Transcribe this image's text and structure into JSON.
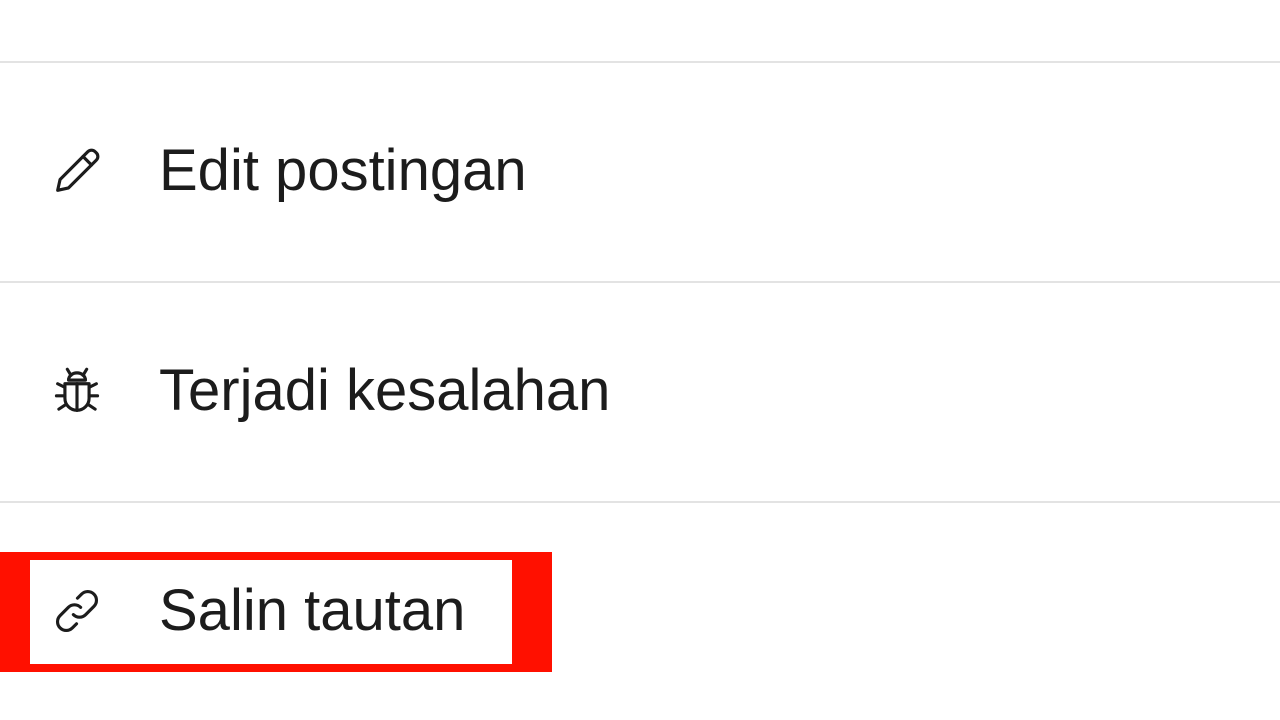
{
  "menu": {
    "items": [
      {
        "label": "Edit postingan",
        "icon": "pencil-icon"
      },
      {
        "label": "Terjadi kesalahan",
        "icon": "bug-icon"
      },
      {
        "label": "Salin tautan",
        "icon": "link-icon"
      }
    ]
  },
  "colors": {
    "highlight": "#ff1000",
    "divider": "#e3e3e3",
    "text": "#1c1c1c"
  }
}
